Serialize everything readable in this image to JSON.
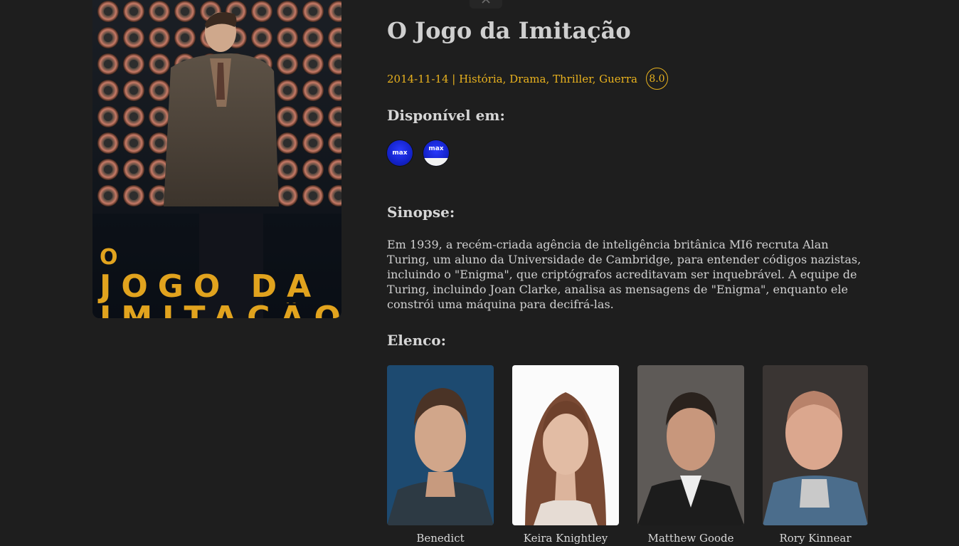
{
  "movie": {
    "title": "O Jogo da Imitação",
    "release_date": "2014-11-14",
    "genres": "História, Drama, Thriller, Guerra",
    "meta_line": "2014-11-14 | História, Drama, Thriller, Guerra",
    "rating": "8.0",
    "poster": {
      "title_small": "O",
      "title_line1": "JOGO DA",
      "title_line2": "IMITAÇÃO"
    }
  },
  "available": {
    "heading": "Disponível em:",
    "providers": [
      {
        "label": "max",
        "icon": "max-logo-icon"
      },
      {
        "label": "max",
        "icon": "max-amazon-channel-icon"
      }
    ]
  },
  "synopsis": {
    "heading": "Sinopse:",
    "text": "Em 1939, a recém-criada agência de inteligência britânica MI6 recruta Alan Turing, um aluno da Universidade de Cambridge, para entender códigos nazistas, incluindo o \"Enigma\", que criptógrafos acreditavam ser inquebrável. A equipe de Turing, incluindo Joan Clarke, analisa as mensagens de \"Enigma\", enquanto ele constrói uma máquina para decifrá-las."
  },
  "cast": {
    "heading": "Elenco:",
    "members": [
      {
        "name": "Benedict"
      },
      {
        "name": "Keira Knightley"
      },
      {
        "name": "Matthew Goode"
      },
      {
        "name": "Rory Kinnear"
      }
    ]
  },
  "colors": {
    "background": "#1e1e1e",
    "accent": "#e9b21e",
    "text": "#d0d0d0"
  }
}
